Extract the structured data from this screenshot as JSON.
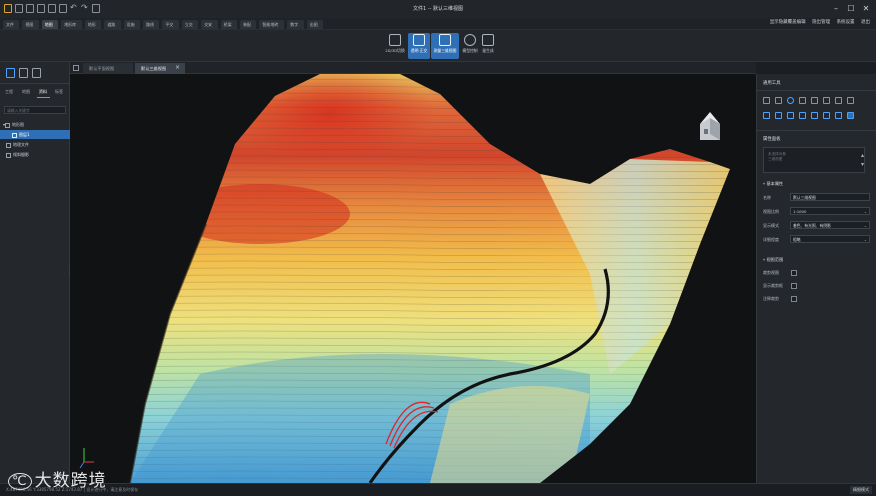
{
  "window": {
    "title": "文件1 -- 默认三维视图",
    "controls": [
      "minimize-icon",
      "maximize-icon",
      "close-icon"
    ]
  },
  "menubar": {
    "tabs": [
      "文件",
      "视图",
      "地图",
      "地形库",
      "地形",
      "道路",
      "设施",
      "路线",
      "平交",
      "立交",
      "交安",
      "桥梁",
      "装配",
      "智能地砖",
      "数字",
      "出图"
    ],
    "active_index": 2,
    "right_items": [
      "显示隐藏覆盖编辑",
      "隐出管理",
      "系统设置",
      "退出"
    ]
  },
  "ribbon": {
    "buttons": [
      {
        "label": "2D/3D切换",
        "icon": "switch-view-icon"
      },
      {
        "label": "透明·正交",
        "icon": "transparency-icon"
      },
      {
        "label": "测量三维视图",
        "icon": "measure-3d-icon"
      },
      {
        "label": "模型控制",
        "icon": "model-control-icon"
      },
      {
        "label": "量生成",
        "icon": "generate-icon"
      }
    ],
    "active_index": 2
  },
  "left_panel": {
    "tabs": [
      "工程",
      "地图",
      "资料",
      "标签"
    ],
    "active_tab": 2,
    "search_placeholder": "请输入关键字",
    "tree": [
      {
        "label": "地形图",
        "level": 0
      },
      {
        "label": "图层1",
        "level": 1,
        "selected": true
      },
      {
        "label": "地理文件",
        "level": 0
      },
      {
        "label": "倾斜摄影",
        "level": 0
      }
    ]
  },
  "doc_tabs": [
    {
      "label": "默认平面视图",
      "active": false
    },
    {
      "label": "默认三维视图",
      "active": true
    }
  ],
  "right_panel": {
    "tools_title": "通用工具",
    "props_title": "属性面板",
    "props_placeholder": "未选择对象\n三维视图",
    "basic_group": "基本属性",
    "fields": [
      {
        "label": "名称",
        "value": "默认三维视图",
        "dropdown": false
      },
      {
        "label": "视图比例",
        "value": "1:1000",
        "dropdown": true
      },
      {
        "label": "显示模式",
        "value": "着色、有光照、有阴影",
        "dropdown": true
      },
      {
        "label": "详细程度",
        "value": "粗略",
        "dropdown": true
      }
    ],
    "range_group": "视图范围",
    "checks": [
      {
        "label": "裁剪视图",
        "checked": false
      },
      {
        "label": "显示裁剪框",
        "checked": false
      },
      {
        "label": "注释裁剪",
        "checked": false
      }
    ]
  },
  "status": {
    "coords": "X:487456.56 Y:3385798.52 Z:1743.87 | 设计进行中，请注意及时保存",
    "right_button": "精细模式"
  },
  "watermark": "大数跨境",
  "colors": {
    "accent": "#2f6fb6",
    "terrain_high": "#d42a1d",
    "terrain_mid": "#f0b545",
    "terrain_low": "#4aa6d8",
    "road": "#1b1b1b"
  }
}
